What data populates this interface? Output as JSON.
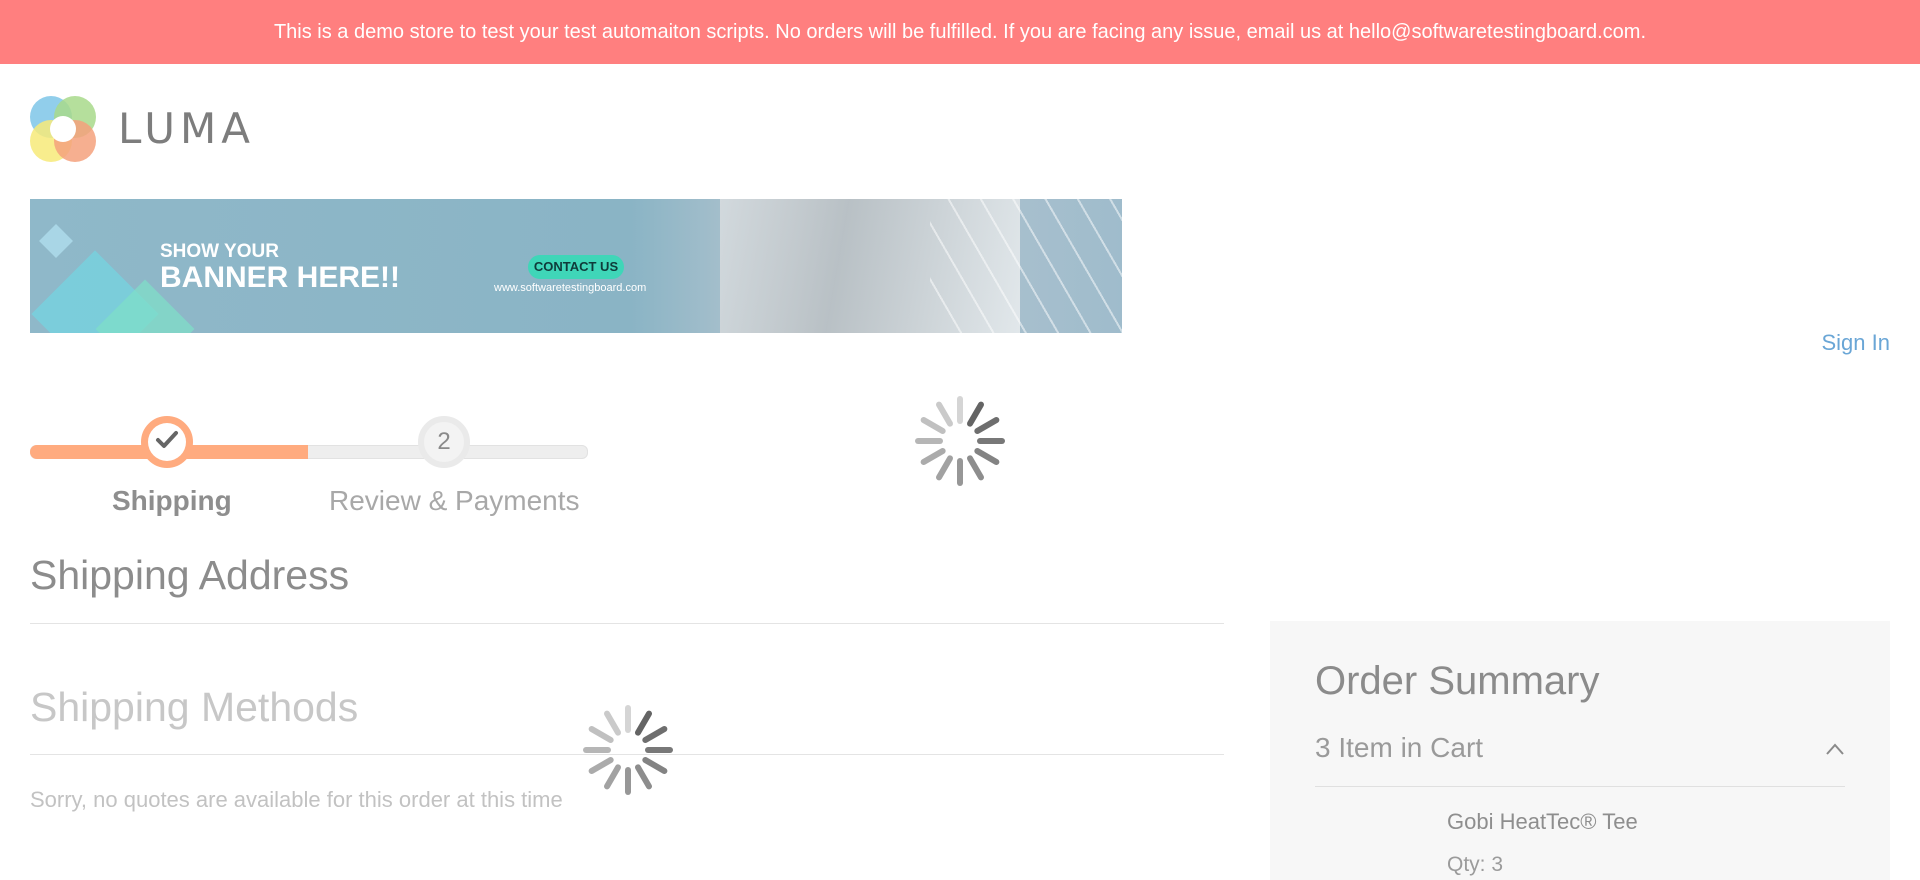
{
  "notice": {
    "text": "This is a demo store to test your test automaiton scripts. No orders will be fulfilled. If you are facing any issue, email us at hello@softwaretestingboard.com."
  },
  "header": {
    "logo_text": "LUMA",
    "sign_in": "Sign In"
  },
  "promo": {
    "line1": "SHOW YOUR",
    "line2": "BANNER HERE!!",
    "button": "CONTACT US",
    "url": "www.softwaretestingboard.com"
  },
  "progress": {
    "steps": [
      {
        "label": "Shipping",
        "state": "complete",
        "icon": "check-icon"
      },
      {
        "label": "Review & Payments",
        "number": "2",
        "state": "pending"
      }
    ],
    "completed_fraction": 0.5,
    "accent_color": "#ffab7f"
  },
  "main": {
    "shipping_address_title": "Shipping Address",
    "shipping_methods_title": "Shipping Methods",
    "no_quotes": "Sorry, no quotes are available for this order at this time"
  },
  "summary": {
    "title": "Order Summary",
    "cart_count": "3 Item in Cart",
    "items": [
      {
        "name": "Gobi HeatTec® Tee",
        "qty": "Qty: 3"
      }
    ]
  },
  "loaders": [
    "loading-spinner-icon",
    "loading-spinner-icon"
  ]
}
